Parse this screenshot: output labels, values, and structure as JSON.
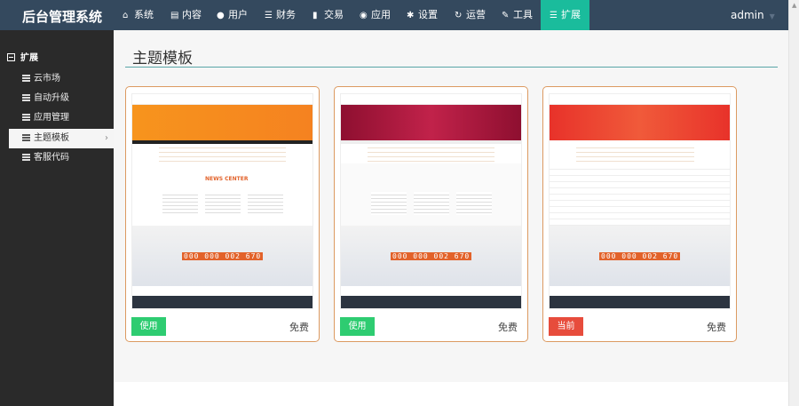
{
  "header": {
    "brand": "后台管理系统",
    "user": "admin",
    "nav": [
      {
        "label": "系统",
        "icon": "home-icon"
      },
      {
        "label": "内容",
        "icon": "document-icon"
      },
      {
        "label": "用户",
        "icon": "user-icon"
      },
      {
        "label": "财务",
        "icon": "list-icon"
      },
      {
        "label": "交易",
        "icon": "bar-chart-icon"
      },
      {
        "label": "应用",
        "icon": "globe-icon"
      },
      {
        "label": "设置",
        "icon": "gear-icon"
      },
      {
        "label": "运营",
        "icon": "share-icon"
      },
      {
        "label": "工具",
        "icon": "wrench-icon"
      },
      {
        "label": "扩展",
        "icon": "menu-icon",
        "active": true
      }
    ]
  },
  "sidebar": {
    "section": "扩展",
    "items": [
      {
        "label": "云市场"
      },
      {
        "label": "自动升级"
      },
      {
        "label": "应用管理"
      },
      {
        "label": "主题模板",
        "active": true
      },
      {
        "label": "客服代码"
      }
    ]
  },
  "main": {
    "title": "主题模板",
    "themes": [
      {
        "button": "使用",
        "price": "免费",
        "banner_color": "#f7941d",
        "counter": "000 000 002 670",
        "news": "NEWS CENTER"
      },
      {
        "button": "使用",
        "price": "免费",
        "banner_color": "#a3163a",
        "counter": "000 000 002 670"
      },
      {
        "button": "当前",
        "price": "免费",
        "banner_color": "#e8322a",
        "counter": "000 000 002 670"
      }
    ]
  },
  "colors": {
    "nav_bg": "#34495e",
    "active": "#1abc9c",
    "use": "#2ecc71",
    "current": "#e74c3c",
    "card_border": "#dc9a61"
  }
}
